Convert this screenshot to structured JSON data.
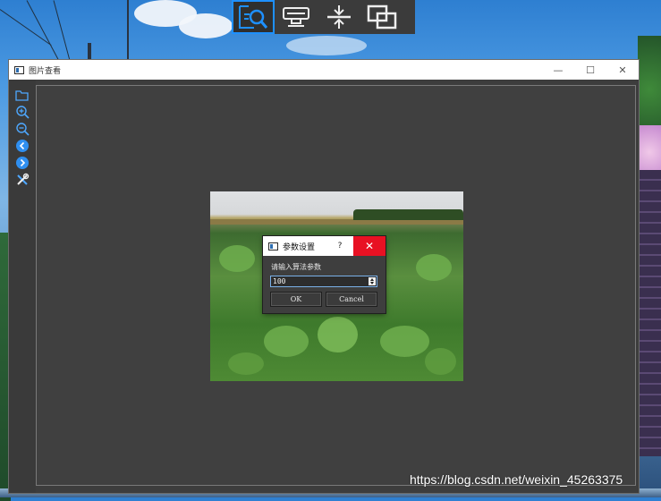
{
  "top_toolbar": {
    "buttons": [
      {
        "icon": "search-document-icon",
        "active": true
      },
      {
        "icon": "monitor-icon",
        "active": false
      },
      {
        "icon": "compress-vertical-icon",
        "active": false
      },
      {
        "icon": "overlap-windows-icon",
        "active": false
      }
    ]
  },
  "window": {
    "title": "图片查看",
    "controls": {
      "minimize": "—",
      "maximize": "☐",
      "close": "✕"
    }
  },
  "side_tools": [
    {
      "icon": "open-folder-icon"
    },
    {
      "icon": "zoom-in-icon"
    },
    {
      "icon": "zoom-out-icon"
    },
    {
      "icon": "previous-icon"
    },
    {
      "icon": "next-icon"
    },
    {
      "icon": "settings-tools-icon"
    }
  ],
  "dialog": {
    "title": "参数设置",
    "help": "?",
    "close": "✕",
    "label": "请输入算法参数",
    "value": "100",
    "ok": "OK",
    "cancel": "Cancel"
  },
  "watermark": "https://blog.csdn.net/weixin_45263375",
  "colors": {
    "accent": "#1e90ff",
    "close_red": "#e81123",
    "panel": "#3d3d3d"
  }
}
